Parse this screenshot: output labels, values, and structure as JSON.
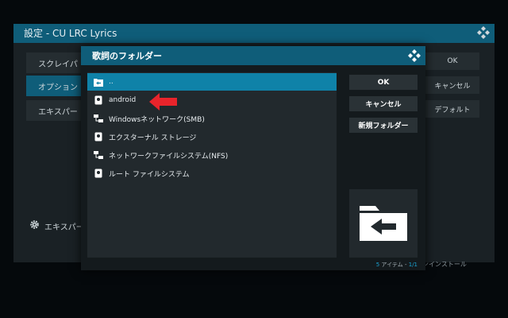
{
  "background": {
    "title": "設定 - CU LRC Lyrics",
    "categories": [
      "スクレイパ",
      "オプション",
      "エキスパー"
    ],
    "buttons": {
      "ok": "OK",
      "cancel": "キャンセル",
      "default": "デフォルト"
    },
    "expert_mode": "エキスパー",
    "install_text": "ンインストール"
  },
  "dialog": {
    "title": "歌詞のフォルダー",
    "items": [
      {
        "label": "..",
        "icon": "folder-back-icon"
      },
      {
        "label": "android",
        "icon": "drive-icon"
      },
      {
        "label": "Windowsネットワーク(SMB)",
        "icon": "network-icon"
      },
      {
        "label": "エクスターナル ストレージ",
        "icon": "drive-icon"
      },
      {
        "label": "ネットワークファイルシステム(NFS)",
        "icon": "network-icon"
      },
      {
        "label": "ルート ファイルシステム",
        "icon": "drive-icon"
      }
    ],
    "selected_index": 0,
    "buttons": {
      "ok": "OK",
      "cancel": "キャンセル",
      "new_folder": "新規フォルダー"
    },
    "count": {
      "num": "5",
      "label": "アイテム",
      "sep": "-",
      "page": "1/1"
    }
  },
  "colors": {
    "accent": "#0f5d79",
    "selected": "#0f82a8",
    "pointer": "#e8242b"
  }
}
